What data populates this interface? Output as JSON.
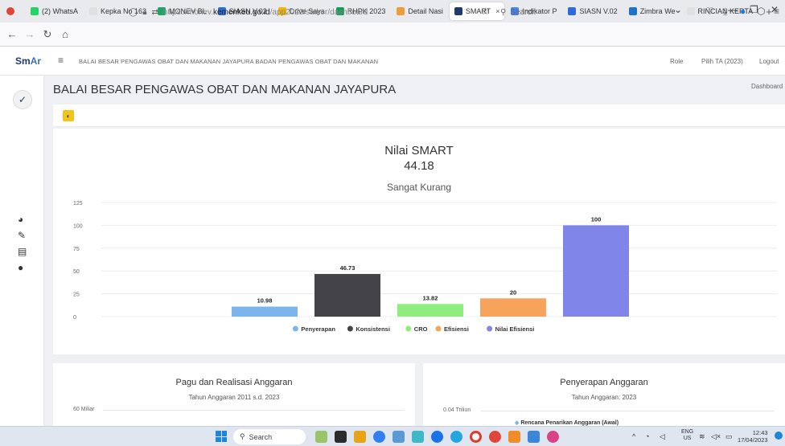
{
  "browser": {
    "tabs": [
      {
        "label": "(2) WhatsA",
        "color": "#25d366",
        "active": false
      },
      {
        "label": "Kepka No 163",
        "color": "#e0e0e0",
        "active": false
      },
      {
        "label": "MONEV BL",
        "color": "#1fa463",
        "active": false
      },
      {
        "label": "SIASN V.02",
        "color": "#2b6cd9",
        "active": false
      },
      {
        "label": "Drive Saya",
        "color": "#f4b400",
        "active": false
      },
      {
        "label": "RHPK 2023",
        "color": "#0f9d58",
        "active": false
      },
      {
        "label": "Detail Nasi",
        "color": "#f29b38",
        "active": false
      },
      {
        "label": "SMART",
        "color": "#1e3a6e",
        "active": true
      },
      {
        "label": "Indikator P",
        "color": "#4285f4",
        "active": false
      },
      {
        "label": "SIASN V.02",
        "color": "#2b6cd9",
        "active": false
      },
      {
        "label": "Zimbra We",
        "color": "#1b74c9",
        "active": false
      },
      {
        "label": "RINCIAN KERTA",
        "color": "#e0e0e0",
        "active": false
      }
    ],
    "new_tab": "+",
    "tab_close": "×",
    "url_prefix": "https://monev.",
    "url_domain": "kemenkeu.go.id",
    "url_path": "/app2023/satker/dashboard",
    "search_placeholder": "Search"
  },
  "header": {
    "logo_a": "Sm",
    "logo_b": "Ar",
    "title": "BALAI BESAR PENGAWAS OBAT DAN MAKANAN JAYAPURA BADAN PENGAWAS OBAT DAN MAKANAN",
    "role": "Role",
    "year_select": "Pilih TA (2023)",
    "logout": "Logout"
  },
  "page": {
    "title": "BALAI BESAR PENGAWAS OBAT DAN MAKANAN JAYAPURA",
    "breadcrumb": "Dashboard"
  },
  "smart": {
    "title": "Nilai SMART",
    "score": "44.18",
    "category": "Sangat Kurang"
  },
  "chart_data": {
    "type": "bar",
    "categories": [
      "Penyerapan",
      "Konsistensi",
      "CRO",
      "Efisiensi",
      "Nilai Efisiensi"
    ],
    "values": [
      10.98,
      46.73,
      13.82,
      20,
      100
    ],
    "colors": [
      "#7cb5ec",
      "#434348",
      "#90ed7d",
      "#f7a35c",
      "#8085e9"
    ],
    "value_labels": [
      "10.98",
      "46.73",
      "13.82",
      "20",
      "100"
    ],
    "ylim": [
      0,
      125
    ],
    "yticks": [
      "0",
      "25",
      "50",
      "75",
      "100",
      "125"
    ],
    "grid": true,
    "legend": "bottom-center",
    "title": "",
    "xlabel": "",
    "ylabel": ""
  },
  "cards": {
    "pagu": {
      "title": "Pagu dan Realisasi Anggaran",
      "subtitle": "Tahun Anggaran 2011 s.d. 2023",
      "axis_top": "60 Miliar"
    },
    "penyerapan": {
      "title": "Penyerapan Anggaran",
      "subtitle": "Tahun Anggaran: 2023",
      "axis_top": "0.04 Triliun",
      "legend_peek": "Rencana Penarikan Anggaran (Awal)"
    }
  },
  "taskbar": {
    "search": "Search",
    "lang_top": "ENG",
    "lang_bottom": "US",
    "time": "12:43",
    "date": "17/04/2023"
  }
}
